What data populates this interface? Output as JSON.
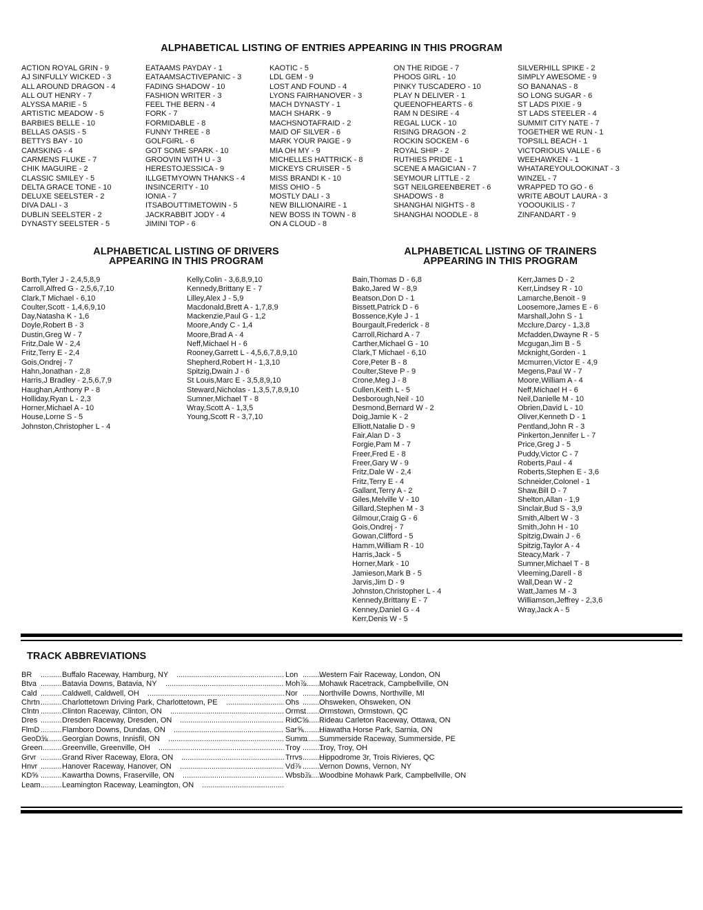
{
  "entries": {
    "title": "ALPHABETICAL LISTING OF ENTRIES APPEARING IN THIS PROGRAM",
    "columns": [
      [
        "ACTION ROYAL GRIN - 9",
        "AJ SINFULLY WICKED - 3",
        "ALL AROUND DRAGON - 4",
        "ALL OUT HENRY - 7",
        "ALYSSA MARIE - 5",
        "ARTISTIC MEADOW - 5",
        "BARBIES BELLE - 10",
        "BELLAS OASIS - 5",
        "BETTYS BAY - 10",
        "CAMSKING - 4",
        "CARMENS FLUKE - 7",
        "CHIK MAGUIRE - 2",
        "CLASSIC SMILEY - 5",
        "DELTA GRACE TONE - 10",
        "DELUXE SEELSTER - 2",
        "DIVA DALI - 3",
        "DUBLIN SEELSTER - 2",
        "DYNASTY SEELSTER - 5"
      ],
      [
        "EATAAMS PAYDAY - 1",
        "EATAAMSACTIVEPANIC - 3",
        "FADING SHADOW - 10",
        "FASHION WRITER - 3",
        "FEEL THE BERN - 4",
        "FORK - 7",
        "FORMIDABLE - 8",
        "FUNNY THREE - 8",
        "GOLFGIRL - 6",
        "GOT SOME SPARK - 10",
        "GROOVIN WITH U - 3",
        "HERESTOJESSICA - 9",
        "ILLGETMYOWN THANKS - 4",
        "INSINCERITY - 10",
        "IONIA - 7",
        "ITSABOUTTIMETOWIN - 5",
        "JACKRABBIT JODY - 4",
        "JIMINI TOP - 6"
      ],
      [
        "KAOTIC - 5",
        "LDL GEM - 9",
        "LOST AND FOUND - 4",
        "LYONS FAIRHANOVER - 3",
        "MACH DYNASTY - 1",
        "MACH SHARK - 9",
        "MACHSNOTAFRAID - 2",
        "MAID OF SILVER - 6",
        "MARK YOUR PAIGE - 9",
        "MIA OH MY - 9",
        "MICHELLES HATTRICK - 8",
        "MICKEYS CRUISER - 5",
        "MISS BRANDI K - 10",
        "MISS OHIO - 5",
        "MOSTLY DALI - 3",
        "NEW BILLIONAIRE - 1",
        "NEW BOSS IN TOWN - 8",
        "ON A CLOUD - 8"
      ],
      [
        "ON THE RIDGE - 7",
        "PHOOS GIRL - 10",
        "PINKY TUSCADERO - 10",
        "PLAY N DELIVER - 1",
        "QUEENOFHEARTS - 6",
        "RAM N DESIRE - 4",
        "REGAL LUCK - 10",
        "RISING DRAGON - 2",
        "ROCKIN SOCKEM - 6",
        "ROYAL SHIP - 2",
        "RUTHIES PRIDE - 1",
        "SCENE A MAGICIAN - 7",
        "SEYMOUR LITTLE - 2",
        "SGT NEILGREENBERET - 6",
        "SHADOWS - 8",
        "SHANGHAI NIGHTS - 8",
        "SHANGHAI NOODLE - 8"
      ],
      [
        "SILVERHILL SPIKE - 2",
        "SIMPLY AWESOME - 9",
        "SO BANANAS - 8",
        "SO LONG SUGAR - 6",
        "ST LADS PIXIE - 9",
        "ST LADS STEELER - 4",
        "SUMMIT CITY NATE - 7",
        "TOGETHER WE RUN - 1",
        "TOPSILL BEACH - 1",
        "VICTORIOUS VALLE - 6",
        "WEEHAWKEN - 1",
        "WHATAREYOULOOKINAT - 3",
        "WINZEL - 7",
        "WRAPPED TO GO - 6",
        "WRITE ABOUT LAURA - 3",
        "YOOOUKILIS - 7",
        "ZINFANDART - 9"
      ]
    ]
  },
  "drivers": {
    "title_line1": "ALPHABETICAL LISTING OF DRIVERS",
    "title_line2": "APPEARING IN THIS PROGRAM",
    "columns": [
      [
        "Borth,Tyler J - 2,4,5,8,9",
        "Carroll,Alfred G - 2,5,6,7,10",
        "Clark,T Michael - 6,10",
        "Coulter,Scott - 1,4,6,9,10",
        "Day,Natasha K - 1,6",
        "Doyle,Robert B - 3",
        "Dustin,Greg W - 7",
        "Fritz,Dale W - 2,4",
        "Fritz,Terry E - 2,4",
        "Gois,Ondrej - 7",
        "Hahn,Jonathan - 2,8",
        "Harris,J Bradley - 2,5,6,7,9",
        "Haughan,Anthony P - 8",
        "Holliday,Ryan L - 2,3",
        "Horner,Michael A - 10",
        "House,Lorne S - 5",
        "Johnston,Christopher L - 4"
      ],
      [
        "Kelly,Colin - 3,6,8,9,10",
        "Kennedy,Brittany E - 7",
        "Lilley,Alex J - 5,9",
        "Macdonald,Brett A - 1,7,8,9",
        "Mackenzie,Paul G - 1,2",
        "Moore,Andy C - 1,4",
        "Moore,Brad A - 4",
        "Neff,Michael H - 6",
        "Rooney,Garrett L - 4,5,6,7,8,9,10",
        "Shepherd,Robert H - 1,3,10",
        "Spitzig,Dwain J - 6",
        "St Louis,Marc E - 3,5,8,9,10",
        "Steward,Nicholas - 1,3,5,7,8,9,10",
        "Sumner,Michael T - 8",
        "Wray,Scott A - 1,3,5",
        "Young,Scott R - 3,7,10"
      ]
    ]
  },
  "trainers": {
    "title_line1": "ALPHABETICAL LISTING OF TRAINERS",
    "title_line2": "APPEARING IN THIS PROGRAM",
    "columns": [
      [
        "Bain,Thomas D - 6,8",
        "Bako,Jared W - 8,9",
        "Beatson,Don D - 1",
        "Bissett,Patrick D - 6",
        "Bossence,Kyle J - 1",
        "Bourgault,Frederick - 8",
        "Carroll,Richard A - 7",
        "Carther,Michael G - 10",
        "Clark,T Michael - 6,10",
        "Core,Peter B - 8",
        "Coulter,Steve P - 9",
        "Crone,Meg J - 8",
        "Cullen,Keith L - 5",
        "Desborough,Neil - 10",
        "Desmond,Bernard W - 2",
        "Doig,Jamie K - 2",
        "Elliott,Natalie D - 9",
        "Fair,Alan D - 3",
        "Forgie,Pam M - 7",
        "Freer,Fred E - 8",
        "Freer,Gary W - 9",
        "Fritz,Dale W - 2,4",
        "Fritz,Terry E - 4",
        "Gallant,Terry A - 2",
        "Giles,Melville V - 10",
        "Gillard,Stephen M - 3",
        "Gilmour,Craig G - 6",
        "Gois,Ondrej - 7",
        "Gowan,Clifford - 5",
        "Hamm,William R - 10",
        "Harris,Jack - 5",
        "Horner,Mark - 10",
        "Jamieson,Mark B - 5",
        "Jarvis,Jim D - 9",
        "Johnston,Christopher L - 4",
        "Kennedy,Brittany E - 7",
        "Kenney,Daniel G - 4",
        "Kerr,Denis W - 5"
      ],
      [
        "Kerr,James D - 2",
        "Kerr,Lindsey R - 10",
        "Lamarche,Benoit - 9",
        "Loosemore,James E - 6",
        "Marshall,John S - 1",
        "Mcclure,Darcy - 1,3,8",
        "Mcfadden,Dwayne R - 5",
        "Mcgugan,Jim B - 5",
        "Mcknight,Gorden - 1",
        "Mcmurren,Victor E - 4,9",
        "Megens,Paul W - 7",
        "Moore,William A - 4",
        "Neff,Michael H - 6",
        "Neil,Danielle M - 10",
        "Obrien,David L - 10",
        "Oliver,Kenneth D - 1",
        "Pentland,John R - 3",
        "Pinkerton,Jennifer L - 7",
        "Price,Greg J - 5",
        "Puddy,Victor C - 7",
        "Roberts,Paul - 4",
        "Roberts,Stephen E - 3,6",
        "Schneider,Colonel - 1",
        "Shaw,Bill D - 7",
        "Shelton,Allan - 1,9",
        "Sinclair,Bud S - 3,9",
        "Smith,Albert W - 3",
        "Smith,John H - 10",
        "Spitzig,Dwain J - 6",
        "Spitzig,Taylor A - 4",
        "Steacy,Mark - 7",
        "Sumner,Michael T - 8",
        "Vleeming,Darell - 8",
        "Wall,Dean W - 2",
        "Watt,James M - 3",
        "Williamson,Jeffrey - 2,3,6",
        "Wray,Jack A - 5"
      ]
    ]
  },
  "tracks": {
    "title": "TRACK ABBREVIATIONS",
    "left": [
      {
        "abbr": "BR",
        "name": "Buffalo Raceway, Hamburg, NY"
      },
      {
        "abbr": "Btva",
        "name": "Batavia Downs, Batavia, NY"
      },
      {
        "abbr": "Cald",
        "name": "Caldwell, Caldwell, OH"
      },
      {
        "abbr": "Chrtn",
        "name": "Charlottetown Driving Park, Charlottetown, PE"
      },
      {
        "abbr": "Clntn",
        "name": "Clinton Raceway, Clinton, ON"
      },
      {
        "abbr": "Dres",
        "name": "Dresden Raceway, Dresden, ON"
      },
      {
        "abbr": "FlmD",
        "name": "Flamboro Downs, Dundas, ON"
      },
      {
        "abbr": "GeoD⅝",
        "name": "Georgian Downs, Innisfil, ON"
      },
      {
        "abbr": "Green",
        "name": "Greenville, Greenville, OH"
      },
      {
        "abbr": "Grvr",
        "name": "Grand River Raceway, Elora, ON"
      },
      {
        "abbr": "Hnvr",
        "name": "Hanover Raceway, Hanover, ON"
      },
      {
        "abbr": "KD⅝",
        "name": "Kawartha Downs, Fraserville, ON"
      },
      {
        "abbr": "Leam",
        "name": "Leamington Raceway, Leamington, ON"
      }
    ],
    "right": [
      {
        "abbr": "Lon",
        "name": "Western Fair Raceway, London, ON"
      },
      {
        "abbr": "Moh⅞",
        "name": "Mohawk Racetrack, Campbellville, ON"
      },
      {
        "abbr": "Nor",
        "name": "Northville Downs, Northville, MI"
      },
      {
        "abbr": "Ohs",
        "name": "Ohsweken, Ohsweken, ON"
      },
      {
        "abbr": "Ormst",
        "name": "Ormstown, Ormstown, QC"
      },
      {
        "abbr": "RidC⅝",
        "name": "Rideau Carleton Raceway, Ottawa, ON"
      },
      {
        "abbr": "Sar⅝",
        "name": "Hiawatha Horse Park, Sarnia, ON"
      },
      {
        "abbr": "Summ",
        "name": "Summerside Raceway, Summerside, PE"
      },
      {
        "abbr": "Troy",
        "name": "Troy, Troy, OH"
      },
      {
        "abbr": "Trrvs",
        "name": "Hippodrome 3r, Trois Rivieres, QC"
      },
      {
        "abbr": "Vd⅞",
        "name": "Vernon Downs, Vernon, NY"
      },
      {
        "abbr": "Wbsb⅞",
        "name": "Woodbine Mohawk Park, Campbellville, ON"
      }
    ]
  }
}
